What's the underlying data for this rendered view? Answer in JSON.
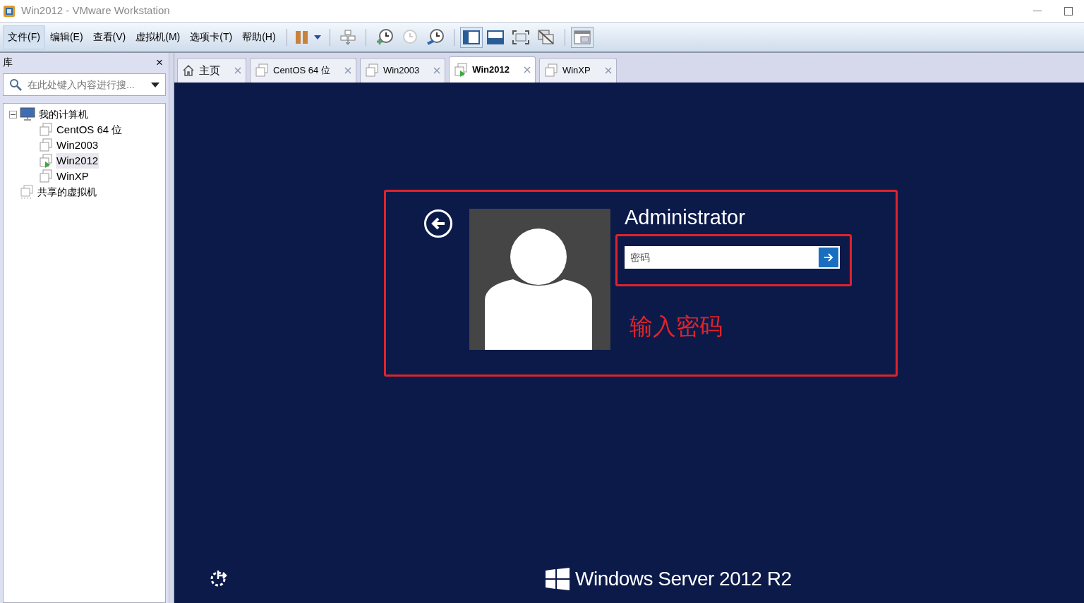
{
  "window": {
    "title": "Win2012 - VMware Workstation"
  },
  "menu": [
    {
      "label": "文件(F)",
      "selected": true
    },
    {
      "label": "编辑(E)",
      "selected": false
    },
    {
      "label": "查看(V)",
      "selected": false
    },
    {
      "label": "虚拟机(M)",
      "selected": false
    },
    {
      "label": "选项卡(T)",
      "selected": false
    },
    {
      "label": "帮助(H)",
      "selected": false
    }
  ],
  "library": {
    "title": "库",
    "close": "×",
    "search": {
      "placeholder": "在此处键入内容进行搜..."
    },
    "tree": [
      {
        "label": "我的计算机",
        "kind": "computer",
        "expanded": true,
        "selected": false,
        "children": [
          {
            "label": "CentOS 64 位",
            "kind": "vm",
            "running": false,
            "selected": false
          },
          {
            "label": "Win2003",
            "kind": "vm",
            "running": false,
            "selected": false
          },
          {
            "label": "Win2012",
            "kind": "vm",
            "running": true,
            "selected": true
          },
          {
            "label": "WinXP",
            "kind": "vm",
            "running": false,
            "selected": false
          }
        ]
      },
      {
        "label": "共享的虚拟机",
        "kind": "shared",
        "selected": false
      }
    ]
  },
  "tabs": [
    {
      "label": "主页",
      "kind": "home",
      "selected": false
    },
    {
      "label": "CentOS 64 位",
      "kind": "vm",
      "running": false,
      "selected": false
    },
    {
      "label": "Win2003",
      "kind": "vm",
      "running": false,
      "selected": false
    },
    {
      "label": "Win2012",
      "kind": "vm",
      "running": true,
      "selected": true
    },
    {
      "label": "WinXP",
      "kind": "vm",
      "running": false,
      "selected": false
    }
  ],
  "vm_screen": {
    "user_name": "Administrator",
    "password": {
      "placeholder": "密码"
    },
    "annotation": "输入密码",
    "brand": "Windows Server 2012 R2"
  }
}
